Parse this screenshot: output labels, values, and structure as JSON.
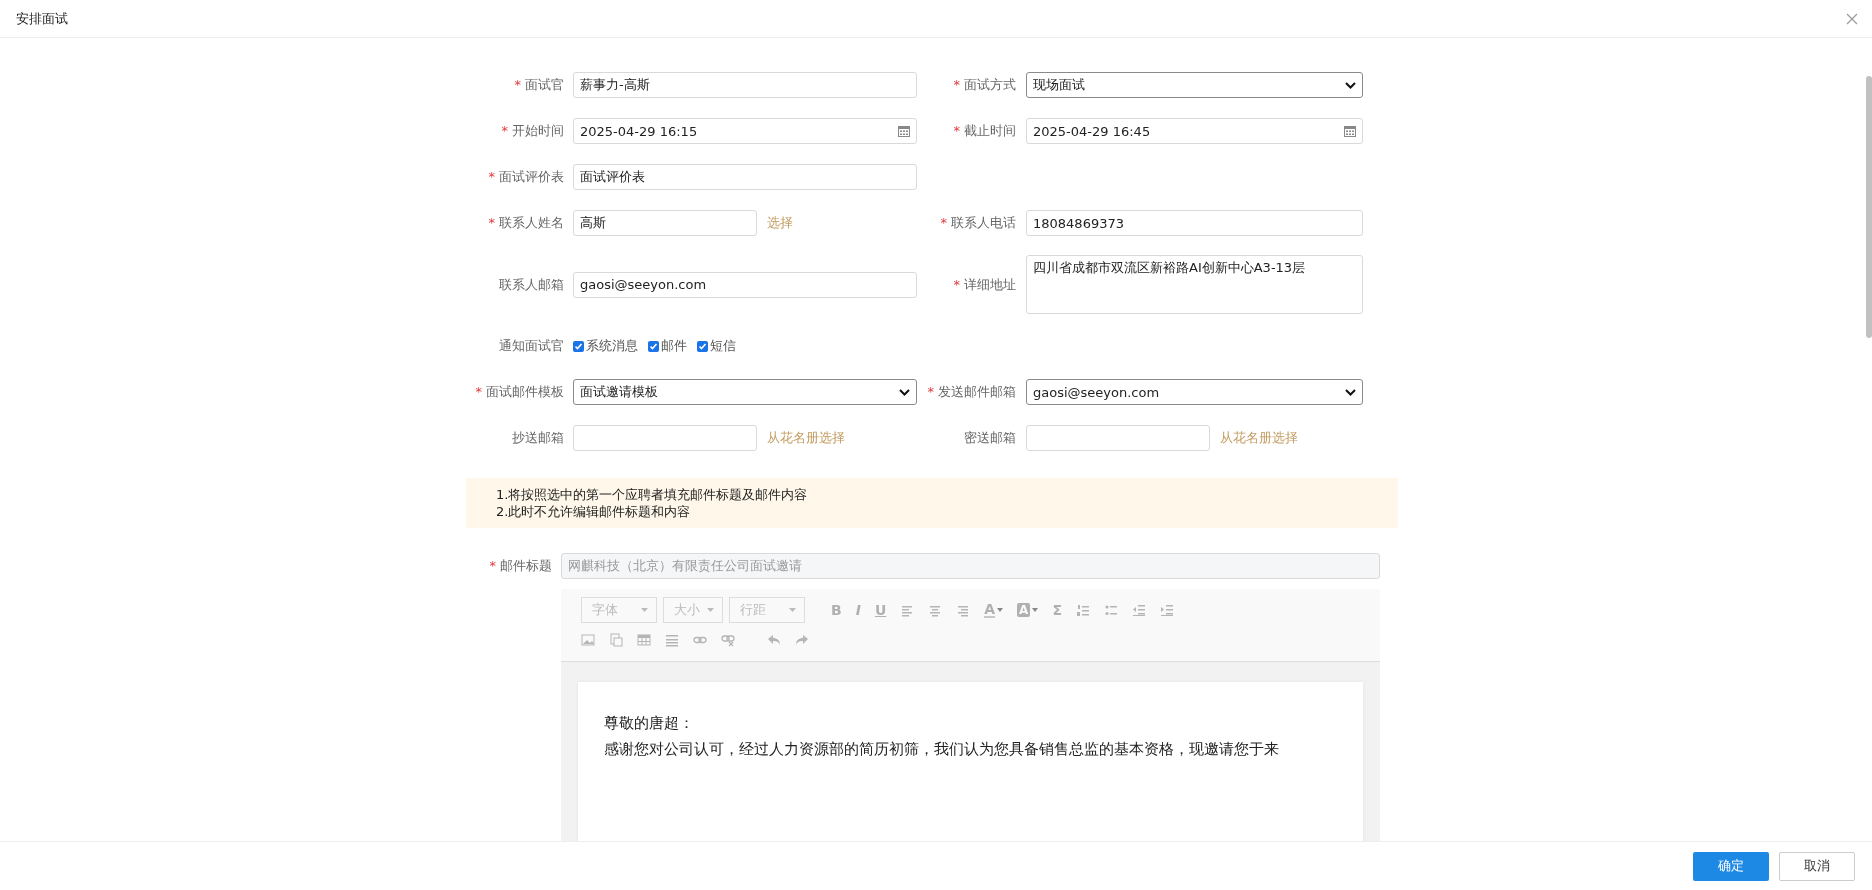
{
  "dialog": {
    "title": "安排面试"
  },
  "rows": [
    {
      "fields": [
        {
          "label": "面试官",
          "marker": "*",
          "kind": "text",
          "value": "薪事力-高斯"
        },
        {
          "label": "面试方式",
          "marker": "*",
          "kind": "select",
          "value": "现场面试"
        }
      ]
    },
    {
      "fields": [
        {
          "label": "开始时间",
          "marker": "*",
          "kind": "date",
          "value": "2025-04-29 16:15"
        },
        {
          "label": "截止时间",
          "marker": "*",
          "kind": "date",
          "value": "2025-04-29 16:45"
        }
      ]
    },
    {
      "fields": [
        {
          "label": "面试评价表",
          "marker": "*",
          "kind": "text",
          "value": "面试评价表"
        }
      ]
    },
    {
      "fields": [
        {
          "label": "联系人姓名",
          "marker": "*",
          "kind": "text",
          "value": "高斯",
          "link": "选择"
        },
        {
          "label": "联系人电话",
          "marker": "*",
          "kind": "text",
          "value": "18084869373"
        }
      ]
    },
    {
      "fields": [
        {
          "label": "联系人邮箱",
          "kind": "text",
          "value": "gaosi@seeyon.com"
        },
        {
          "label": "详细地址",
          "marker": "*",
          "kind": "textarea",
          "value": "四川省成都市双流区新裕路AI创新中心A3-13层"
        }
      ]
    },
    {
      "fields": [
        {
          "label": "通知面试官",
          "kind": "checkboxes",
          "options": [
            {
              "label": "系统消息",
              "checked": true
            },
            {
              "label": "邮件",
              "checked": true
            },
            {
              "label": "短信",
              "checked": true
            }
          ]
        }
      ]
    },
    {
      "fields": [
        {
          "label": "面试邮件模板",
          "marker": "*",
          "kind": "select",
          "value": "面试邀请模板"
        },
        {
          "label": "发送邮件邮箱",
          "marker": "*",
          "kind": "select",
          "value": "gaosi@seeyon.com"
        }
      ]
    },
    {
      "fields": [
        {
          "label": "抄送邮箱",
          "kind": "text",
          "link": "从花名册选择"
        },
        {
          "label": "密送邮箱",
          "kind": "text",
          "link": "从花名册选择"
        }
      ]
    }
  ],
  "notice": [
    "1.将按照选中的第一个应聘者填充邮件标题及邮件内容",
    "2.此时不允许编辑邮件标题和内容"
  ],
  "email_subject": {
    "label": "邮件标题",
    "marker": "*",
    "value": "网麒科技（北京）有限责任公司面试邀请",
    "disabled": true
  },
  "editor": {
    "dropdowns": [
      "字体",
      "大小",
      "行距"
    ],
    "glyphs": [
      "B",
      "I",
      "U",
      "A",
      "A",
      "Σ"
    ],
    "body": [
      "尊敬的唐超：",
      "感谢您对公司认可，经过人力资源部的简历初筛，我们认为您具备销售总监的基本资格，现邀请您于来"
    ]
  },
  "buttons": [
    {
      "label": "确定",
      "kind": "primary"
    },
    {
      "label": "取消",
      "kind": "default"
    }
  ]
}
